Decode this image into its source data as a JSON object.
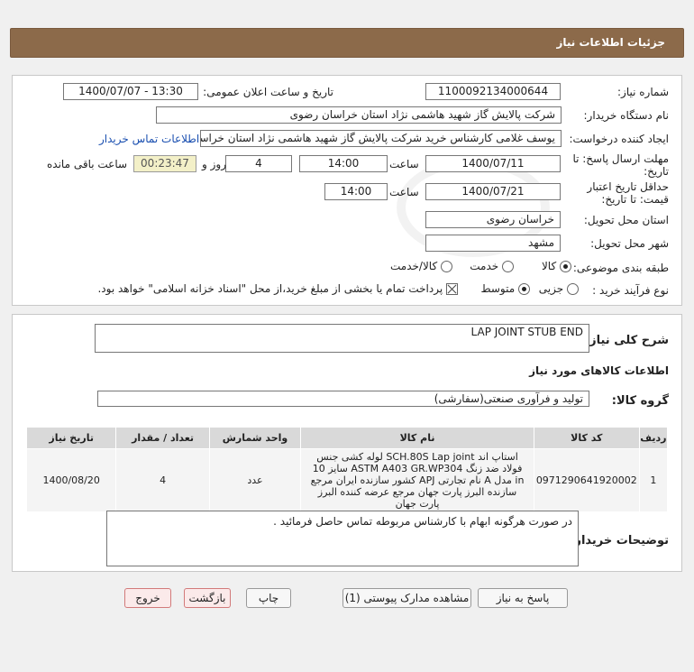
{
  "header": {
    "title": "جزئیات اطلاعات نیاز"
  },
  "form": {
    "need_number_label": "شماره نیاز:",
    "need_number": "1100092134000644",
    "announce_label": "تاریخ و ساعت اعلان عمومی:",
    "announce_value": "1400/07/07 - 13:30",
    "buyer_label": "نام دستگاه خریدار:",
    "buyer_value": "شرکت پالایش گاز شهید هاشمی نژاد   استان خراسان رضوی",
    "creator_label": "ایجاد کننده درخواست:",
    "creator_value": "یوسف غلامی کارشناس خرید شرکت پالایش گاز شهید هاشمی نژاد   استان خراسان رضوی",
    "contact_link": "اطلاعات تماس خریدار",
    "deadline_label_1": "مهلت ارسال پاسخ: تا",
    "deadline_label_2": "تاریخ:",
    "deadline_date": "1400/07/11",
    "time_label": "ساعت",
    "deadline_time": "14:00",
    "days_value": "4",
    "days_label": "روز و",
    "remaining_time": "00:23:47",
    "remaining_label": "ساعت باقی مانده",
    "validity_label_1": "حداقل تاریخ اعتبار",
    "validity_label_2": "قیمت: تا تاریخ:",
    "validity_date": "1400/07/21",
    "validity_time": "14:00",
    "province_label": "استان محل تحویل:",
    "province_value": "خراسان رضوی",
    "city_label": "شهر محل تحویل:",
    "city_value": "مشهد",
    "category_label": "طبقه بندی موضوعی:",
    "category_options": [
      "کالا",
      "خدمت",
      "کالا/خدمت"
    ],
    "process_label": "نوع فرآیند خرید :",
    "process_options": [
      "جزیی",
      "متوسط"
    ],
    "payment_note": "پرداخت تمام یا بخشی از مبلغ خرید،از محل \"اسناد خزانه اسلامی\" خواهد بود."
  },
  "details": {
    "summary_label": "شرح کلی نیاز:",
    "summary_value": "LAP JOINT STUB END",
    "goods_info_title": "اطلاعات کالاهای مورد نیاز",
    "group_label": "گروه کالا:",
    "group_value": "تولید و فرآوری صنعتی(سفارشی)",
    "table": {
      "headers": [
        "ردیف",
        "کد کالا",
        "نام کالا",
        "واحد شمارش",
        "تعداد / مقدار",
        "تاریخ نیاز"
      ],
      "rows": [
        {
          "row": "1",
          "code": "0971290641920002",
          "name": "استاپ اند SCH.80S Lap joint لوله کشی جنس فولاد ضد زنگ ASTM A403 GR.WP304 سایز 10 in مدل A نام تجارتی APJ کشور سازنده ایران مرجع سازنده البرز پارت جهان مرجع عرضه کننده البرز پارت جهان",
          "unit": "عدد",
          "qty": "4",
          "date": "1400/08/20"
        }
      ]
    },
    "buyer_notes_label": "توضیحات خریدار:",
    "buyer_notes_value": "در صورت هرگونه ابهام با کارشناس مربوطه تماس حاصل فرمائید ."
  },
  "buttons": {
    "reply": "پاسخ به نیاز",
    "docs": "مشاهده مدارک پیوستی (1)",
    "print": "چاپ",
    "back": "بازگشت",
    "exit": "خروج"
  }
}
